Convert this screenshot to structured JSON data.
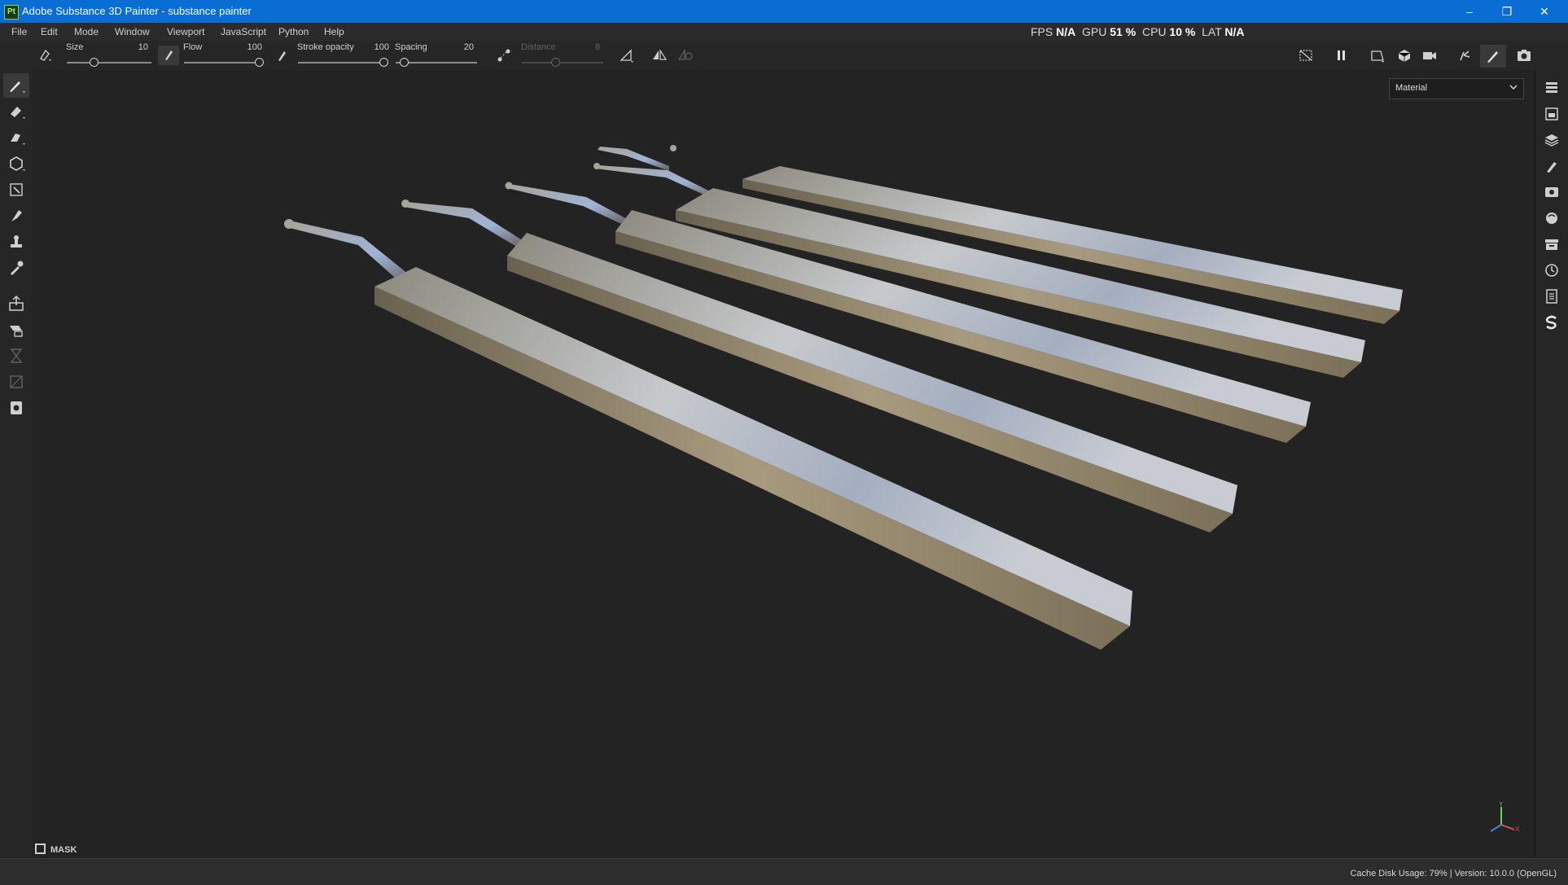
{
  "window": {
    "app_icon": "Pt",
    "title": "Adobe Substance 3D Painter - substance painter",
    "minimize": "–",
    "restore": "❐",
    "close": "✕"
  },
  "menu": [
    "File",
    "Edit",
    "Mode",
    "Window",
    "Viewport",
    "JavaScript",
    "Python",
    "Help"
  ],
  "perf": {
    "fps_label": "FPS",
    "fps_value": "N/A",
    "gpu_label": "GPU",
    "gpu_value": "51 %",
    "cpu_label": "CPU",
    "cpu_value": "10 %",
    "lat_label": "LAT",
    "lat_value": "N/A"
  },
  "toolbar": {
    "size_label": "Size",
    "size_value": "10",
    "flow_label": "Flow",
    "flow_value": "100",
    "stroke_opacity_label": "Stroke opacity",
    "stroke_opacity_value": "100",
    "spacing_label": "Spacing",
    "spacing_value": "20",
    "distance_label": "Distance",
    "distance_value": "8"
  },
  "left_tools": [
    "paint-brush-icon",
    "eraser-icon",
    "projection-icon",
    "geometry-fill-icon",
    "polygon-fill-icon",
    "smudge-icon",
    "clone-stamp-icon",
    "color-picker-icon",
    "bake-icon",
    "quick-mask-icon",
    "hourglass-icon",
    "uv-tile-icon",
    "export-icon"
  ],
  "right_tools": [
    "texture-set-list-icon",
    "texture-set-settings-icon",
    "layers-icon",
    "properties-icon",
    "display-settings-icon",
    "shader-settings-icon",
    "assets-icon",
    "history-icon",
    "log-icon",
    "substance-icon"
  ],
  "viewport": {
    "channel_select": "Material",
    "mask_label": "MASK",
    "axis_y": "Y",
    "axis_x": "X"
  },
  "status": {
    "text": "Cache Disk Usage:   79% | Version: 10.0.0 (OpenGL)"
  },
  "colors": {
    "titlebar": "#0a6dd3",
    "panel": "#262626",
    "viewport": "#232323"
  }
}
